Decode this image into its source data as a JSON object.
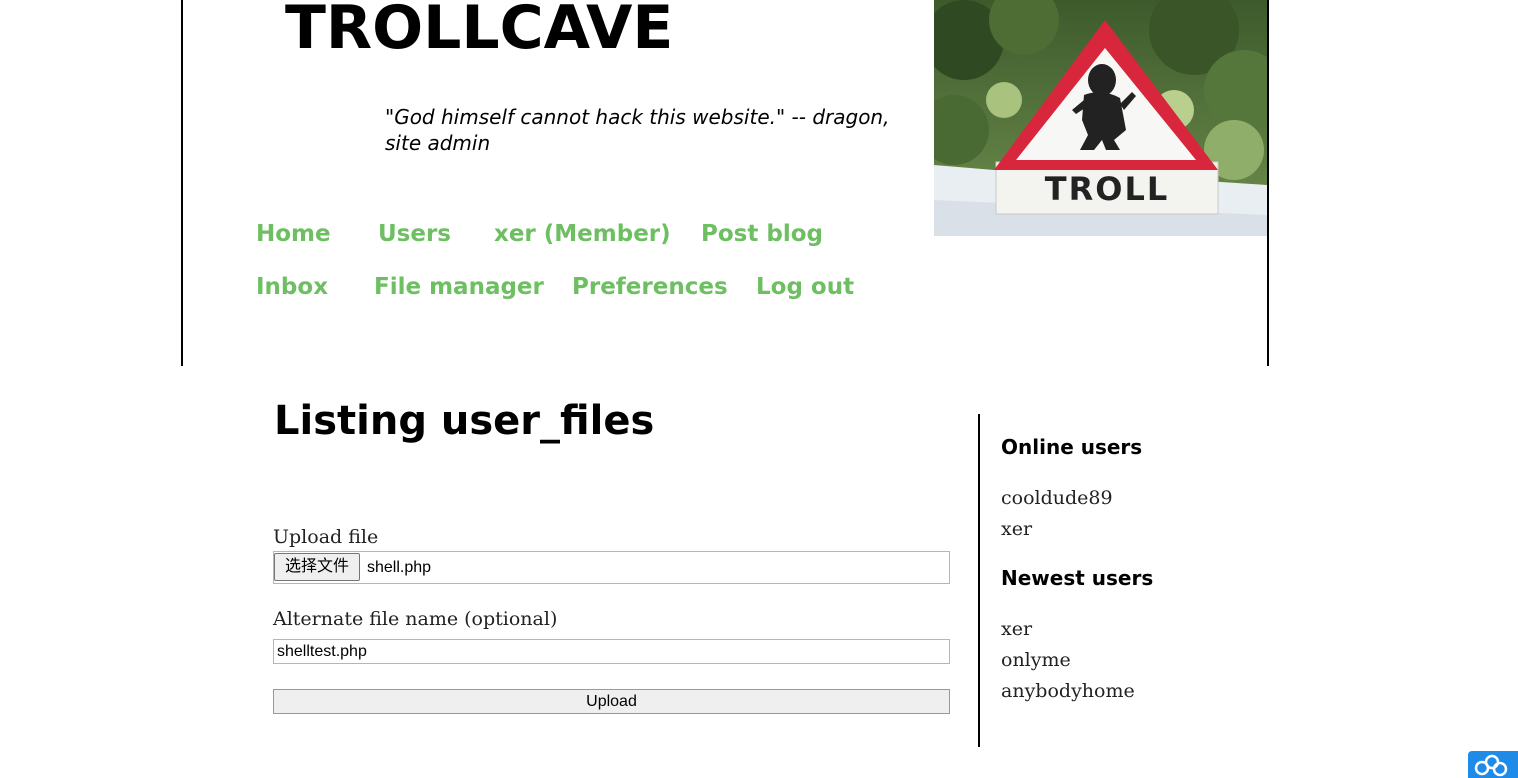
{
  "header": {
    "site_title": "TROLLCAVE",
    "quote": "\"God himself cannot hack this website.\" -- dragon, site admin",
    "banner_sign_text": "TROLL"
  },
  "nav": {
    "items": [
      {
        "label": "Home"
      },
      {
        "label": "Users"
      },
      {
        "label": "xer (Member)"
      },
      {
        "label": "Post blog"
      },
      {
        "label": "Inbox"
      },
      {
        "label": "File manager"
      },
      {
        "label": "Preferences"
      },
      {
        "label": "Log out"
      }
    ]
  },
  "main": {
    "title": "Listing user_files",
    "upload_label": "Upload file",
    "choose_file_label": "选择文件",
    "chosen_file": "shell.php",
    "alt_name_label": "Alternate file name (optional)",
    "alt_name_value": "shelltest.php",
    "upload_button": "Upload"
  },
  "sidebar": {
    "online_title": "Online users",
    "online_users": [
      "cooldude89",
      "xer"
    ],
    "newest_title": "Newest users",
    "newest_users": [
      "xer",
      "onlyme",
      "anybodyhome"
    ]
  },
  "colors": {
    "nav_link": "#6dbf62",
    "widget": "#1e8be8"
  }
}
